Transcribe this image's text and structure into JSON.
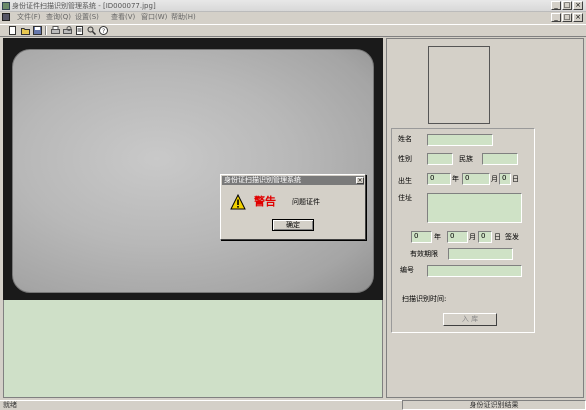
{
  "window": {
    "title": "身份证件扫描识别管理系统 - [ID000077.jpg]",
    "controls": {
      "min": "_",
      "max": "□",
      "close": "×"
    },
    "mdi_controls": {
      "min": "_",
      "restore": "□",
      "close": "×"
    }
  },
  "menubar": {
    "items": [
      "文件(F)",
      "查询(Q)",
      "设置(S)",
      "查看(V)",
      "窗口(W)",
      "帮助(H)"
    ]
  },
  "toolbar": {
    "icons": [
      "new-file-icon",
      "open-folder-icon",
      "save-icon",
      "print-icon",
      "print-preview-icon",
      "scan-icon",
      "recognize-icon",
      "about-icon"
    ]
  },
  "form": {
    "name_label": "姓名",
    "name_value": "",
    "gender_label": "性别",
    "gender_value": "",
    "nation_label": "民族",
    "nation_value": "",
    "birth_label": "出生",
    "birth_year": "0",
    "birth_year_unit": "年",
    "birth_month": "0",
    "birth_month_unit": "月",
    "birth_day": "0",
    "birth_day_unit": "日",
    "address_label": "住址",
    "address_value": "",
    "issue_year": "0",
    "issue_year_unit": "年",
    "issue_month": "0",
    "issue_month_unit": "月",
    "issue_day": "0",
    "issue_day_unit": "日",
    "issue_suffix": "签发",
    "validity_label": "有效期限",
    "validity_value": "",
    "number_label": "编号",
    "number_value": "",
    "scan_time_label": "扫描识别时间:",
    "import_button": "入 库"
  },
  "dialog": {
    "title": "身份证扫描识别管理系统",
    "close": "×",
    "heading": "警告",
    "message": "问题证件",
    "ok_button": "确定",
    "icon": "warning-icon"
  },
  "statusbar": {
    "left": "就绪",
    "right": "身份证识别结果"
  },
  "colors": {
    "field_bg": "#cfe2c6",
    "warning_red": "#e00000"
  }
}
